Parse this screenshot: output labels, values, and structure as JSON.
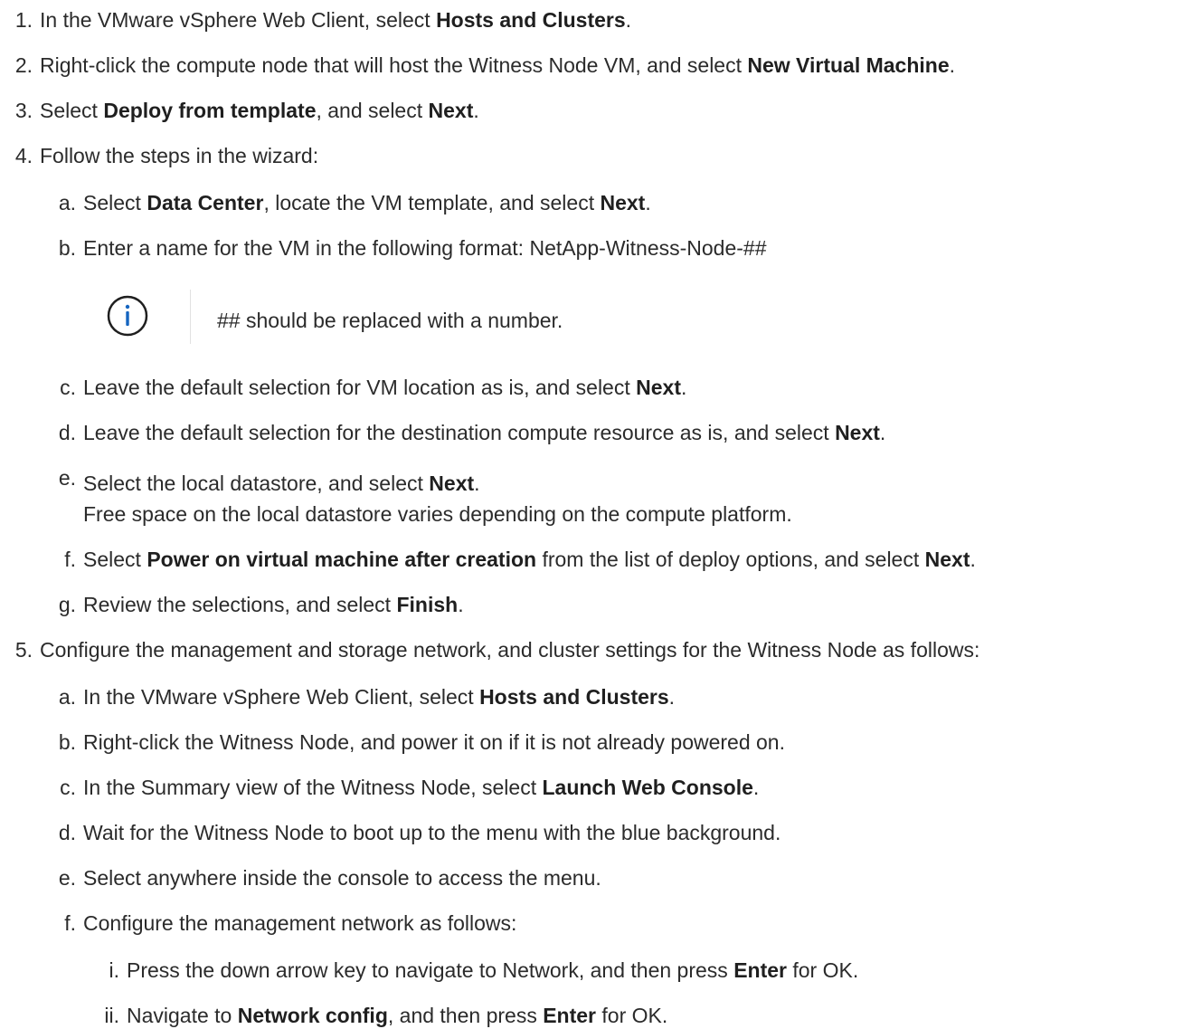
{
  "steps": [
    {
      "num": "1.",
      "parts": [
        {
          "t": "In the VMware vSphere Web Client, select "
        },
        {
          "t": "Hosts and Clusters",
          "b": true
        },
        {
          "t": "."
        }
      ]
    },
    {
      "num": "2.",
      "parts": [
        {
          "t": "Right-click the compute node that will host the Witness Node VM, and select "
        },
        {
          "t": "New Virtual Machine",
          "b": true
        },
        {
          "t": "."
        }
      ]
    },
    {
      "num": "3.",
      "parts": [
        {
          "t": "Select "
        },
        {
          "t": "Deploy from template",
          "b": true
        },
        {
          "t": ", and select "
        },
        {
          "t": "Next",
          "b": true
        },
        {
          "t": "."
        }
      ]
    },
    {
      "num": "4.",
      "parts": [
        {
          "t": "Follow the steps in the wizard:"
        }
      ]
    },
    {
      "num": "a.",
      "parts": [
        {
          "t": "Select "
        },
        {
          "t": "Data Center",
          "b": true
        },
        {
          "t": ", locate the VM template, and select "
        },
        {
          "t": "Next",
          "b": true
        },
        {
          "t": "."
        }
      ]
    },
    {
      "num": "b.",
      "parts": [
        {
          "t": "Enter a name for the VM in the following format: NetApp-Witness-Node-##"
        }
      ]
    },
    {
      "num": "c.",
      "parts": [
        {
          "t": "Leave the default selection for VM location as is, and select "
        },
        {
          "t": "Next",
          "b": true
        },
        {
          "t": "."
        }
      ]
    },
    {
      "num": "d.",
      "parts": [
        {
          "t": "Leave the default selection for the destination compute resource as is, and select "
        },
        {
          "t": "Next",
          "b": true
        },
        {
          "t": "."
        }
      ]
    },
    {
      "num": "e.",
      "parts": [
        {
          "t": "Select the local datastore, and select "
        },
        {
          "t": "Next",
          "b": true
        },
        {
          "t": "."
        }
      ]
    },
    {
      "num": "f.",
      "parts": [
        {
          "t": "Select "
        },
        {
          "t": "Power on virtual machine after creation",
          "b": true
        },
        {
          "t": " from the list of deploy options, and select "
        },
        {
          "t": "Next",
          "b": true
        },
        {
          "t": "."
        }
      ]
    },
    {
      "num": "g.",
      "parts": [
        {
          "t": "Review the selections, and select "
        },
        {
          "t": "Finish",
          "b": true
        },
        {
          "t": "."
        }
      ]
    },
    {
      "num": "5.",
      "parts": [
        {
          "t": "Configure the management and storage network, and cluster settings for the Witness Node as follows:"
        }
      ]
    },
    {
      "num": "a.",
      "parts": [
        {
          "t": "In the VMware vSphere Web Client, select "
        },
        {
          "t": "Hosts and Clusters",
          "b": true
        },
        {
          "t": "."
        }
      ]
    },
    {
      "num": "b.",
      "parts": [
        {
          "t": "Right-click the Witness Node, and power it on if it is not already powered on."
        }
      ]
    },
    {
      "num": "c.",
      "parts": [
        {
          "t": "In the Summary view of the Witness Node, select "
        },
        {
          "t": "Launch Web Console",
          "b": true
        },
        {
          "t": "."
        }
      ]
    },
    {
      "num": "d.",
      "parts": [
        {
          "t": "Wait for the Witness Node to boot up to the menu with the blue background."
        }
      ]
    },
    {
      "num": "e.",
      "parts": [
        {
          "t": "Select anywhere inside the console to access the menu."
        }
      ]
    },
    {
      "num": "f.",
      "parts": [
        {
          "t": "Configure the management network as follows:"
        }
      ]
    },
    {
      "num": "i.",
      "parts": [
        {
          "t": "Press the down arrow key to navigate to Network, and then press "
        },
        {
          "t": "Enter",
          "b": true
        },
        {
          "t": " for OK."
        }
      ]
    },
    {
      "num": "ii.",
      "parts": [
        {
          "t": "Navigate to "
        },
        {
          "t": "Network config",
          "b": true
        },
        {
          "t": ", and then press "
        },
        {
          "t": "Enter",
          "b": true
        },
        {
          "t": " for OK."
        }
      ]
    }
  ],
  "step_e_continuation": "Free space on the local datastore varies depending on the compute platform.",
  "note": {
    "icon": "info-icon",
    "text": "## should be replaced with a number."
  },
  "colors": {
    "text": "#2b2b2b",
    "icon": "#1565c0",
    "divider": "#e1e1e1"
  }
}
